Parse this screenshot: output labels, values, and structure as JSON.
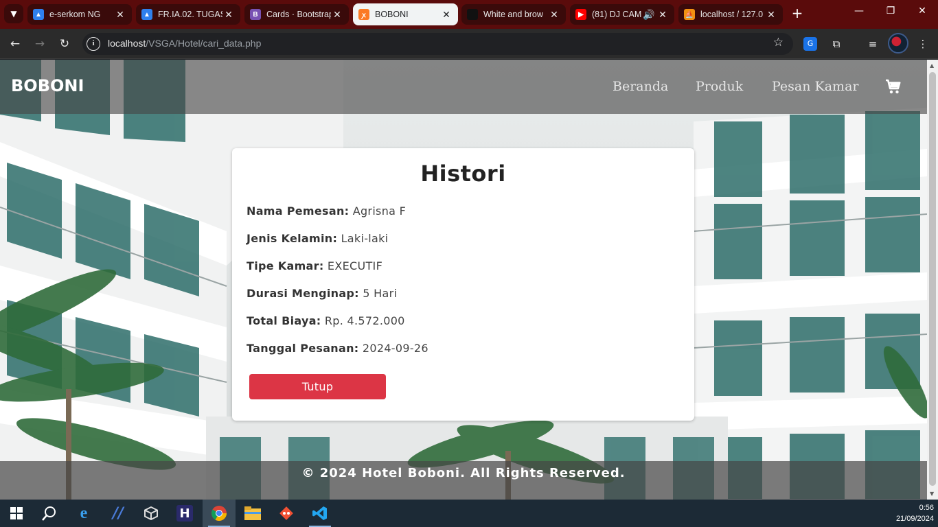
{
  "browser": {
    "tabs": [
      {
        "title": "e-serkom NG",
        "favicon": "triangle-icon",
        "color": "#2f80ed"
      },
      {
        "title": "FR.IA.02. TUGAS",
        "favicon": "triangle-icon",
        "color": "#2f80ed"
      },
      {
        "title": "Cards · Bootstrap",
        "favicon": "bootstrap-icon",
        "color": "#7952b3"
      },
      {
        "title": "BOBONI",
        "favicon": "xampp-icon",
        "color": "#fb7a24",
        "active": true
      },
      {
        "title": "White and brow",
        "favicon": "dark-icon",
        "color": "#111111"
      },
      {
        "title": "(81) DJ CAM",
        "favicon": "youtube-icon",
        "color": "#ff0000"
      },
      {
        "title": "localhost / 127.0",
        "favicon": "phpmyadmin-icon",
        "color": "#f29111"
      }
    ],
    "url_host": "localhost",
    "url_path": "/VSGA/Hotel/cari_data.php",
    "accent": "#5a0b0b"
  },
  "site": {
    "brand": "BOBONI",
    "nav": [
      "Beranda",
      "Produk",
      "Pesan Kamar"
    ],
    "card": {
      "title": "Histori",
      "rows": [
        {
          "label": "Nama Pemesan:",
          "value": "Agrisna F"
        },
        {
          "label": "Jenis Kelamin:",
          "value": "Laki-laki"
        },
        {
          "label": "Tipe Kamar:",
          "value": "EXECUTIF"
        },
        {
          "label": "Durasi Menginap:",
          "value": "5 Hari"
        },
        {
          "label": "Total Biaya:",
          "value": "Rp. 4.572.000"
        },
        {
          "label": "Tanggal Pesanan:",
          "value": "2024-09-26"
        }
      ],
      "close_label": "Tutup",
      "close_color": "#dc3545"
    },
    "footer": "© 2024 Hotel Boboni. All Rights Reserved."
  },
  "taskbar": {
    "apps": [
      "windows-start-icon",
      "search-icon",
      "internet-explorer-icon",
      "visual-studio-icon",
      "cube-icon",
      "h-app-icon",
      "chrome-icon",
      "file-explorer-icon",
      "git-icon",
      "vscode-icon"
    ],
    "time": "0:56",
    "date": "21/09/2024"
  }
}
